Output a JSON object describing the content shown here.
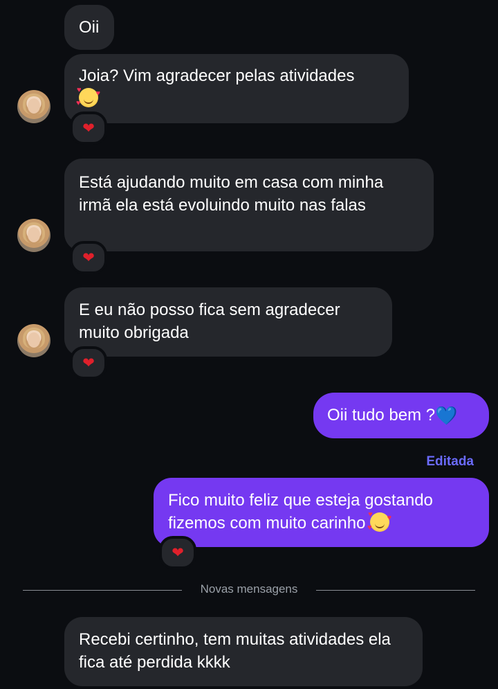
{
  "messages": [
    {
      "id": "m1",
      "direction": "in",
      "text": "Oii"
    },
    {
      "id": "m2",
      "direction": "in",
      "text": "Joia? Vim agradecer pelas atividades",
      "emoji": "smiling-face-with-hearts"
    },
    {
      "id": "m3",
      "direction": "in",
      "text": "Está ajudando muito em casa com minha irmã ela está evoluindo muito nas falas"
    },
    {
      "id": "m4",
      "direction": "in",
      "text": "E eu não posso fica sem agradecer muito obrigada"
    },
    {
      "id": "m5",
      "direction": "out",
      "text": "Oii tudo bem ?",
      "emoji": "blue-heart"
    },
    {
      "id": "m6",
      "direction": "out",
      "text": "Fico muito feliz que esteja gostando fizemos com muito carinho",
      "emoji": "smiling-face-with-hearts",
      "edited_label": "Editada"
    },
    {
      "id": "m7",
      "direction": "in",
      "text": "Recebi certinho, tem muitas atividades ela fica até perdida kkkk"
    }
  ],
  "reactions": {
    "m2": "❤️",
    "m3": "❤️",
    "m4": "❤️",
    "m6": "❤️"
  },
  "divider": {
    "label": "Novas mensagens"
  },
  "colors": {
    "background": "#0b0d11",
    "incoming_bubble": "#25272c",
    "outgoing_bubble": "#7539f1",
    "edited_label": "#6b6bff",
    "heart": "#e0202b"
  }
}
